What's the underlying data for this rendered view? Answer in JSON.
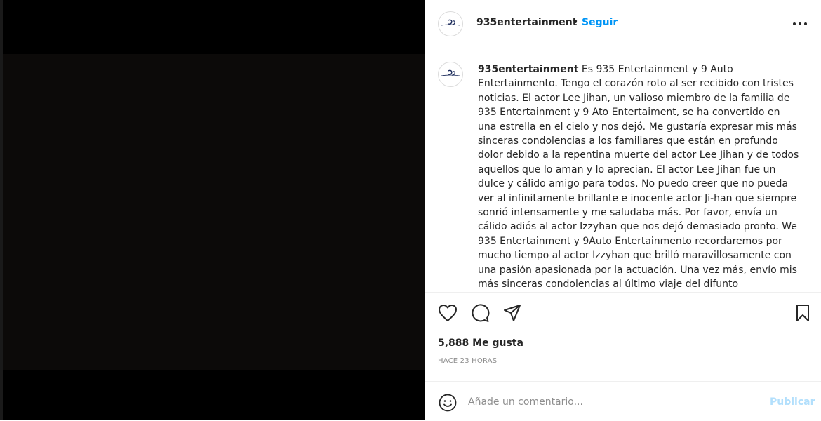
{
  "post": {
    "username": "935entertainment",
    "dot": "•",
    "follow_label": "Seguir",
    "more_icon": "more-horizontal-icon",
    "caption_text": " Es 935 Entertainment y 9 Auto Entertainmento. Tengo el corazón roto al ser recibido con tristes noticias. El actor Lee Jihan, un valioso miembro de la familia de 935 Entertainment y 9 Ato Entertaiment, se ha convertido en una estrella en el cielo y nos dejó. Me gustaría expresar mis más sinceras condolencias a los familiares que están en profundo dolor debido a la repentina muerte del actor Lee Jihan y de todos aquellos que lo aman y lo aprecian. El actor Lee Jihan fue un dulce y cálido amigo para todos. No puedo creer que no pueda ver al infinitamente brillante e inocente actor Ji-han que siempre sonrió intensamente y me saludaba más. Por favor, envía un cálido adiós al actor Izzyhan que nos dejó demasiado pronto. We 935 Entertainment y 9Auto Entertainmento recordaremos por mucho tiempo al actor Izzyhan que brilló maravillosamente con una pasión apasionada por la actuación. Una vez más, envío mis más sinceras condolencias al último viaje del difunto",
    "likes": "5,888 Me gusta",
    "time_ago": "HACE 23 HORAS"
  },
  "actions": {
    "like_icon": "heart-icon",
    "comment_icon": "comment-icon",
    "share_icon": "paper-plane-icon",
    "save_icon": "bookmark-icon"
  },
  "comment": {
    "placeholder": "Añade un comentario...",
    "post_label": "Publicar",
    "emoji_icon": "smiley-icon"
  },
  "colors": {
    "accent": "#0095f6",
    "post_disabled": "#b2dffc",
    "media_bg": "#000000"
  }
}
